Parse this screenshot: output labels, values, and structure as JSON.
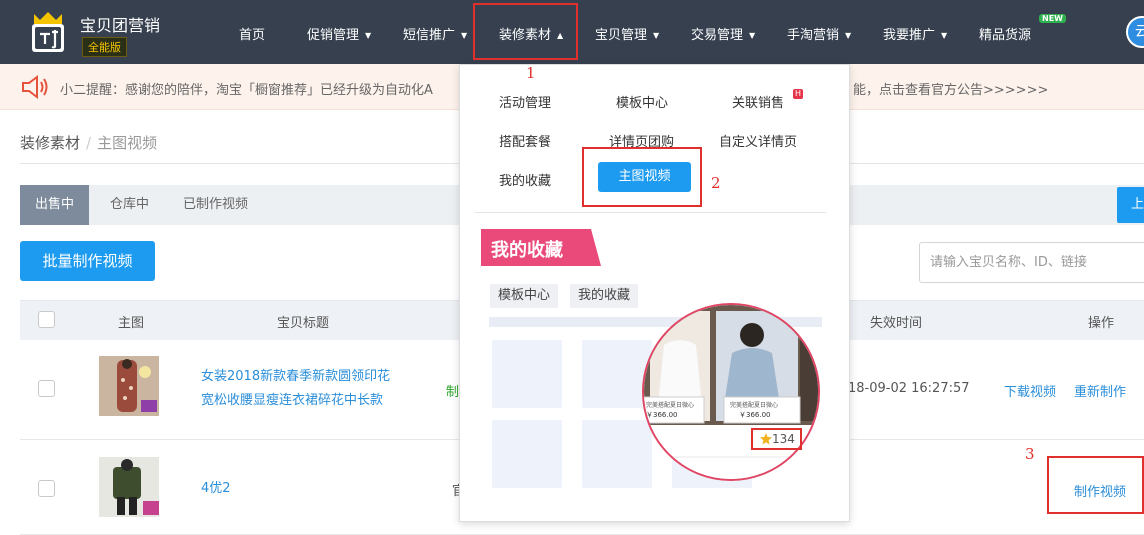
{
  "app": {
    "brand": "宝贝团营销",
    "edition": "全能版"
  },
  "nav": {
    "items": [
      "首页",
      "促销管理",
      "短信推广",
      "装修素材",
      "宝贝管理",
      "交易管理",
      "手淘营销",
      "我要推广",
      "精品货源"
    ],
    "new_badge": "NEW",
    "avatar_char": "云"
  },
  "notice": {
    "text_left": "小二提醒：感谢您的陪伴，淘宝「橱窗推荐」已经升级为自动化A",
    "text_right": "能，点击查看官方公告>>>>>>"
  },
  "breadcrumb": {
    "parent": "装修素材",
    "separator": "/",
    "current": "主图视频"
  },
  "tabs": [
    "出售中",
    "仓库中",
    "已制作视频"
  ],
  "toolbar": {
    "batch_button": "批量制作视频",
    "upload_partial": "上",
    "search_placeholder": "请输入宝贝名称、ID、链接"
  },
  "table": {
    "headers": {
      "image": "主图",
      "title": "宝贝标题",
      "expire": "失效时间",
      "ops": "操作"
    },
    "rows": [
      {
        "title_line1": "女装2018新款春季新款圆领印花",
        "title_line2": "宽松收腰显瘦连衣裙碎花中长款",
        "status": "制",
        "expire": "18-09-02 16:27:57",
        "op1": "下载视频",
        "op2": "重新制作"
      },
      {
        "title_line1": "4优2",
        "status": "官",
        "op1": "制作视频"
      }
    ]
  },
  "dropdown": {
    "items": [
      "活动管理",
      "模板中心",
      "关联销售",
      "搭配套餐",
      "详情页团购",
      "自定义详情页",
      "我的收藏",
      "主图视频"
    ],
    "hot_badge": "H",
    "favorites_banner": "我的收藏",
    "chips": [
      "模板中心",
      "我的收藏"
    ],
    "price_label": "￥366.00",
    "card_caption": "完美搭配夏日微心",
    "star_count": "134"
  },
  "annotations": [
    "1",
    "2",
    "3"
  ],
  "colors": {
    "nav_bg": "#36404f",
    "primary": "#1d9bf0",
    "link": "#2a8ed9",
    "annotation_red": "#e0302d",
    "banner_pink": "#ea4a7a"
  }
}
